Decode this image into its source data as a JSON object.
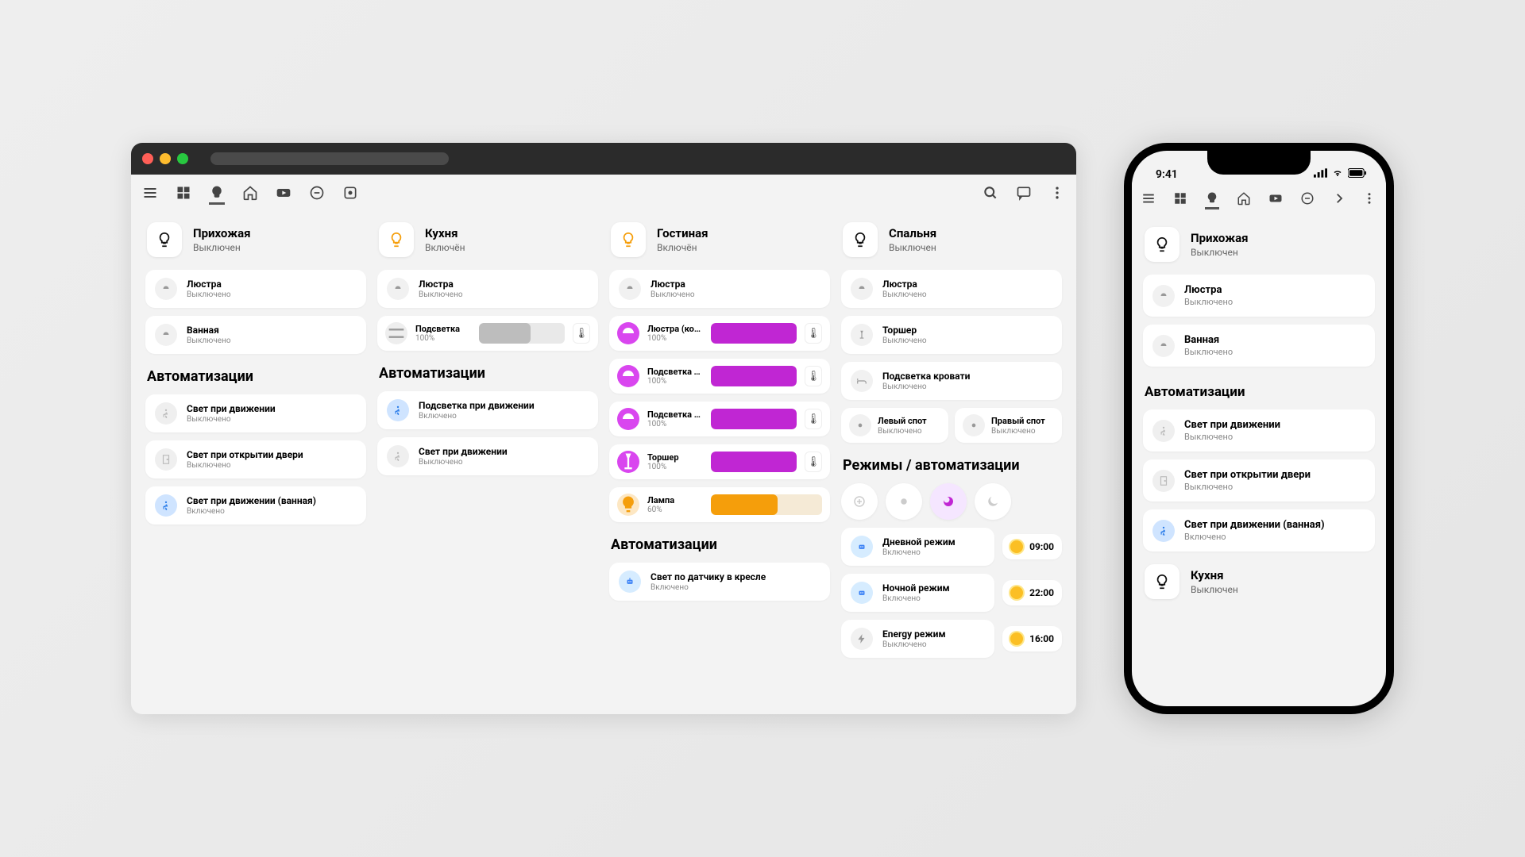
{
  "statusbar": {
    "time": "9:41"
  },
  "labels": {
    "automations": "Автоматизации",
    "modes": "Режимы / автоматизации",
    "off": "Выключено",
    "on": "Включено",
    "room_off": "Выключен",
    "room_on": "Включён"
  },
  "rooms": {
    "hall": {
      "title": "Прихожая",
      "state": "Выключен"
    },
    "kitchen": {
      "title": "Кухня",
      "state": "Включён"
    },
    "living": {
      "title": "Гостиная",
      "state": "Включён"
    },
    "bedroom": {
      "title": "Спальня",
      "state": "Выключен"
    }
  },
  "hall": {
    "devices": [
      {
        "name": "Люстра",
        "state": "Выключено"
      },
      {
        "name": "Ванная",
        "state": "Выключено"
      }
    ],
    "autos": [
      {
        "name": "Свет при движении",
        "state": "Выключено",
        "style": "gray"
      },
      {
        "name": "Свет при открытии двери",
        "state": "Выключено",
        "style": "door"
      },
      {
        "name": "Свет при движении (ванная)",
        "state": "Включено",
        "style": "blue"
      }
    ]
  },
  "kitchen": {
    "devices": [
      {
        "name": "Люстра",
        "state": "Выключено"
      },
      {
        "name": "Подсветка",
        "state": "100%",
        "slider": true,
        "pct": 60,
        "color": "dark"
      }
    ],
    "autos": [
      {
        "name": "Подсветка при движении",
        "state": "Включено",
        "style": "blue"
      },
      {
        "name": "Свет при движении",
        "state": "Выключено",
        "style": "gray"
      }
    ]
  },
  "living": {
    "devices": [
      {
        "name": "Люстра",
        "state": "Выключено"
      },
      {
        "name": "Люстра (контур)",
        "state": "100%",
        "slider": true,
        "pct": 100,
        "color": "purple"
      },
      {
        "name": "Подсветка ТВ",
        "state": "100%",
        "slider": true,
        "pct": 100,
        "color": "purple"
      },
      {
        "name": "Подсветка сто...",
        "state": "100%",
        "slider": true,
        "pct": 100,
        "color": "purple"
      },
      {
        "name": "Торшер",
        "state": "100%",
        "slider": true,
        "pct": 100,
        "color": "purple"
      },
      {
        "name": "Лампа",
        "state": "60%",
        "slider": true,
        "pct": 60,
        "color": "orange"
      }
    ],
    "autos": [
      {
        "name": "Свет по датчику в кресле",
        "state": "Включено",
        "style": "robot"
      }
    ]
  },
  "bedroom": {
    "devices": [
      {
        "name": "Люстра",
        "state": "Выключено"
      },
      {
        "name": "Торшер",
        "state": "Выключено"
      },
      {
        "name": "Подсветка кровати",
        "state": "Выключено"
      }
    ],
    "spots": [
      {
        "name": "Левый спот",
        "state": "Выключено"
      },
      {
        "name": "Правый спот",
        "state": "Выключено"
      }
    ],
    "modes": [
      {
        "name": "Дневной режим",
        "state": "Включено",
        "time": "09:00"
      },
      {
        "name": "Ночной режим",
        "state": "Включено",
        "time": "22:00"
      },
      {
        "name": "Energy режим",
        "state": "Выключено",
        "time": "16:00"
      }
    ]
  },
  "phone": {
    "room2": {
      "title": "Кухня",
      "state": "Выключен"
    }
  }
}
